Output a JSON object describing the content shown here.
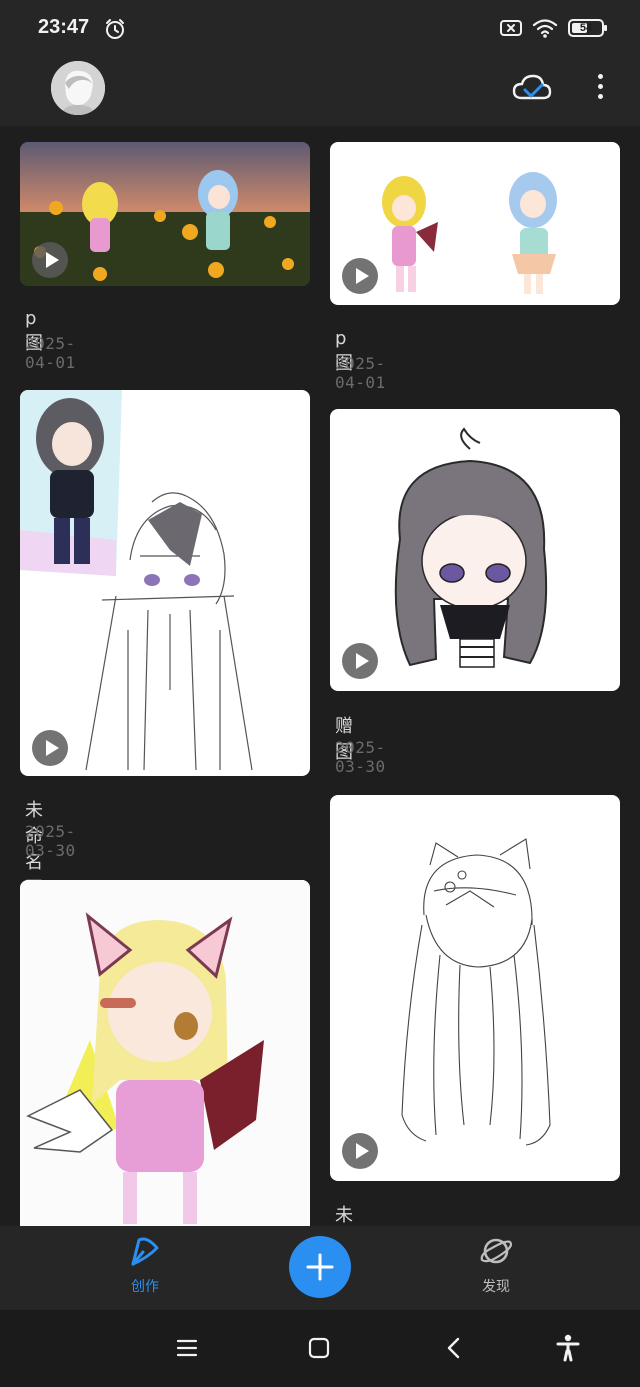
{
  "status_bar": {
    "time": "23:47",
    "battery": "54",
    "battery_level": 0.54
  },
  "app_bar": {
    "avatar_icon": "user-avatar",
    "cloud_icon": "cloud-sync-check-icon",
    "more_icon": "more-vertical-icon"
  },
  "artworks": [
    {
      "title": "p图",
      "date": "2025-04-01"
    },
    {
      "title": "p图",
      "date": "2025-04-01"
    },
    {
      "title": "未命名画布",
      "date": "2025-03-30"
    },
    {
      "title": "赠图",
      "date": "2025-03-30"
    },
    {
      "title": "",
      "date": ""
    },
    {
      "title": "未命名画布",
      "date": ""
    }
  ],
  "bottom_nav": {
    "create_label": "创作",
    "discover_label": "发现",
    "active_color": "#2b8ff2"
  },
  "system_nav": [
    "menu-icon",
    "home-icon",
    "back-icon",
    "accessibility-icon"
  ]
}
